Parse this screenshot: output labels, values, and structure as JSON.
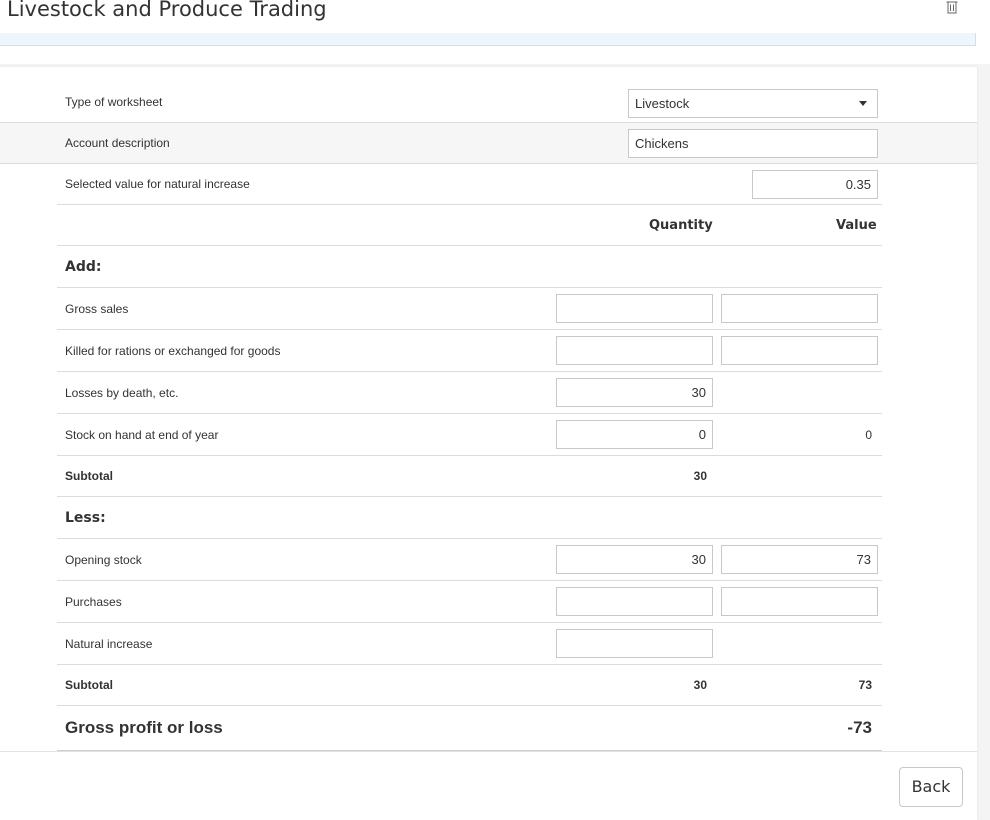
{
  "page": {
    "title": "Livestock and Produce Trading"
  },
  "icons": {
    "delete": "trash-icon"
  },
  "form": {
    "worksheet_type_label": "Type of worksheet",
    "worksheet_type_value": "Livestock",
    "account_description_label": "Account description",
    "account_description_value": "Chickens",
    "natural_increase_value_label": "Selected value for natural increase",
    "natural_increase_value": "0.35"
  },
  "table": {
    "columns": {
      "quantity": "Quantity",
      "value": "Value"
    },
    "add": {
      "heading": "Add:",
      "rows": [
        {
          "label": "Gross sales",
          "quantity": "",
          "value": ""
        },
        {
          "label": "Killed for rations or exchanged for goods",
          "quantity": "",
          "value": ""
        },
        {
          "label": "Losses by death, etc.",
          "quantity": "30"
        },
        {
          "label": "Stock on hand at end of year",
          "quantity": "0",
          "value": "0"
        }
      ],
      "subtotal": {
        "label": "Subtotal",
        "quantity": "30",
        "value": ""
      }
    },
    "less": {
      "heading": "Less:",
      "rows": [
        {
          "label": "Opening stock",
          "quantity": "30",
          "value": "73"
        },
        {
          "label": "Purchases",
          "quantity": "",
          "value": ""
        },
        {
          "label": "Natural increase",
          "quantity": ""
        }
      ],
      "subtotal": {
        "label": "Subtotal",
        "quantity": "30",
        "value": "73"
      }
    },
    "gross_profit": {
      "label": "Gross profit or loss",
      "value": "-73"
    }
  },
  "footer": {
    "back_label": "Back"
  }
}
